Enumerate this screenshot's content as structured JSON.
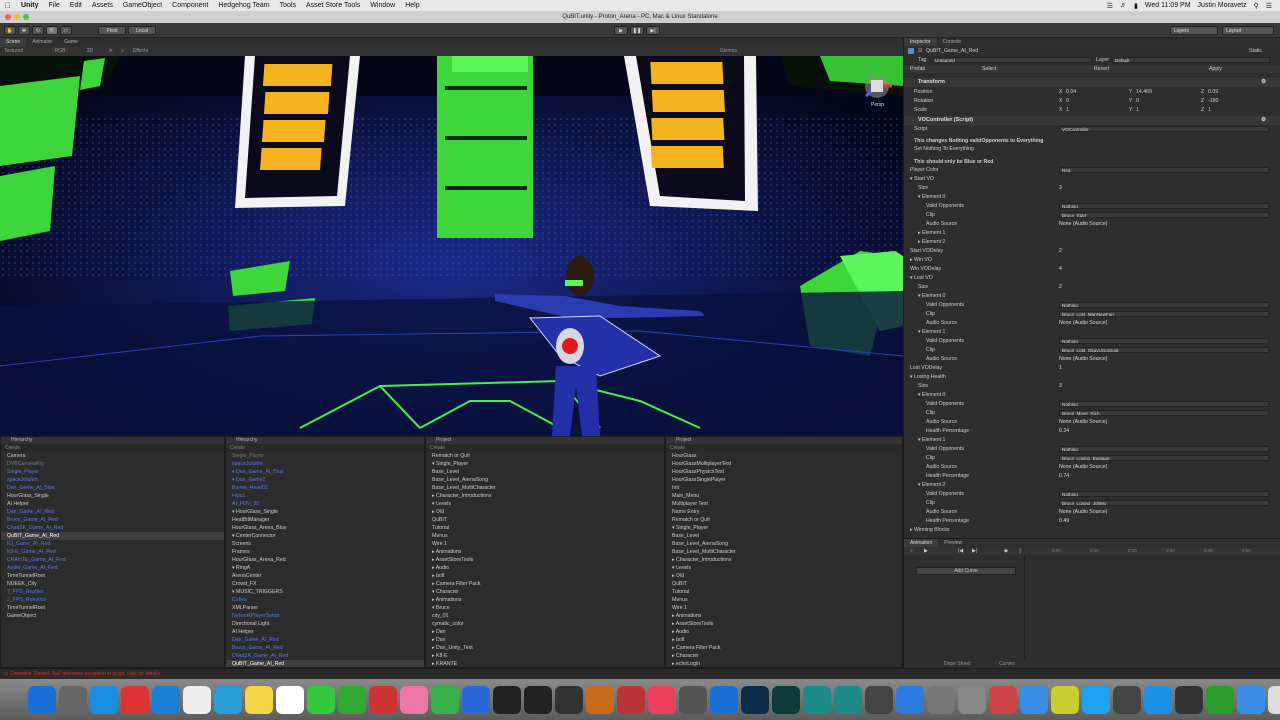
{
  "menubar": {
    "app": "Unity",
    "items": [
      "File",
      "Edit",
      "Assets",
      "GameObject",
      "Component",
      "Hedgehog Team",
      "Tools",
      "Asset Store Tools",
      "Window",
      "Help"
    ],
    "clock": "Wed 11:09 PM",
    "user": "Justin Moravetz"
  },
  "window_title": "QuBIT.unity - Proton_Arena - PC, Mac & Linux Standalone",
  "toolbar": {
    "pivot": "Pivot",
    "local": "Local",
    "layers": "Layers",
    "layout": "Layout"
  },
  "scene": {
    "tabs": [
      "Scene",
      "Animator",
      "Game"
    ],
    "shading": "Textured",
    "mode": "RGB",
    "twod": "2D",
    "effects": "Effects",
    "gizmos": "Gizmos",
    "persp": "Persp"
  },
  "hierarchy_left": {
    "title": "Hierarchy",
    "create": "Create",
    "items": [
      {
        "t": "Camera",
        "c": "n"
      },
      {
        "t": "DVBCameraRig",
        "c": "dim"
      },
      {
        "t": "Single_Player",
        "c": "blue"
      },
      {
        "t": "spaceJoluhm",
        "c": "blue"
      },
      {
        "t": "Dan_Game_AI_Blue",
        "c": "blue"
      },
      {
        "t": "HourGlass_Single",
        "c": "n"
      },
      {
        "t": "AI Helper",
        "c": "n"
      },
      {
        "t": "Dan_Game_AI_Red",
        "c": "blue"
      },
      {
        "t": "Bruce_Game_AI_Red",
        "c": "blue"
      },
      {
        "t": "ChadZK_Game_AI_Red",
        "c": "blue"
      },
      {
        "t": "QuBIT_Game_AI_Red",
        "c": "sel"
      },
      {
        "t": "Kit_Game_AI_Red",
        "c": "blue"
      },
      {
        "t": "K8-E_Game_AI_Red",
        "c": "blue"
      },
      {
        "t": "CRANTE_Game_AI_Red",
        "c": "blue"
      },
      {
        "t": "Audio_Game_AI_Red",
        "c": "blue"
      },
      {
        "t": "TimeTunnelRoot",
        "c": "n"
      },
      {
        "t": "NUEEK_City",
        "c": "n"
      },
      {
        "t": "7_FPS_Reptiler",
        "c": "blue"
      },
      {
        "t": "2_FPS_Robotics",
        "c": "blue"
      },
      {
        "t": "TimeTunnelRoot",
        "c": "n"
      },
      {
        "t": "GameObject",
        "c": "n"
      }
    ]
  },
  "hierarchy_right": {
    "title": "Hierarchy",
    "create": "Create",
    "items": [
      {
        "t": "Single_Player",
        "c": "dim"
      },
      {
        "t": "spaceJoluhm",
        "c": "blue"
      },
      {
        "t": "▾ Dan_Game_AI_Blue",
        "c": "blue"
      },
      {
        "t": "  ▾ Dan_Game2",
        "c": "blue"
      },
      {
        "t": "     Bones_Head03",
        "c": "blue"
      },
      {
        "t": "     Hips1",
        "c": "blue"
      },
      {
        "t": "     AI_FOV_90",
        "c": "blue"
      },
      {
        "t": "▾ HourGlass_Single",
        "c": "n"
      },
      {
        "t": "   HeatBitManager",
        "c": "n"
      },
      {
        "t": "   HourGlass_Arena_Blue",
        "c": "n"
      },
      {
        "t": "  ▾ CenterConnector",
        "c": "n"
      },
      {
        "t": "     Screens",
        "c": "n"
      },
      {
        "t": "     Frames",
        "c": "n"
      },
      {
        "t": "   HourGlass_Arena_Red",
        "c": "n"
      },
      {
        "t": "  ▾ RingA",
        "c": "n"
      },
      {
        "t": "   ArenaCenter",
        "c": "n"
      },
      {
        "t": "   Crowd_FX",
        "c": "n"
      },
      {
        "t": "  ▾ MUSIC_TRIGGERS",
        "c": "n"
      },
      {
        "t": "     Cubes",
        "c": "blue"
      },
      {
        "t": "     XMLParser",
        "c": "n"
      },
      {
        "t": "   NetworkPlayerSetup",
        "c": "blue"
      },
      {
        "t": "   Directional Light",
        "c": "n"
      },
      {
        "t": "AI Helper",
        "c": "n"
      },
      {
        "t": "Dan_Game_AI_Red",
        "c": "blue"
      },
      {
        "t": "Bruce_Game_AI_Red",
        "c": "blue"
      },
      {
        "t": "ChadZK_Game_AI_Red",
        "c": "blue"
      },
      {
        "t": "QuBIT_Game_AI_Red",
        "c": "sel"
      }
    ]
  },
  "project_left": {
    "title": "Project",
    "create": "Create",
    "items": [
      {
        "t": "    Rematch or Quit",
        "c": "n"
      },
      {
        "t": "  ▾ Single_Player",
        "c": "n"
      },
      {
        "t": "     Base_Level",
        "c": "n"
      },
      {
        "t": "     Base_Level_ArenaSong",
        "c": "n"
      },
      {
        "t": "     Base_Level_MultiCharacter",
        "c": "n"
      },
      {
        "t": "   ▸ Character_Introductions",
        "c": "n"
      },
      {
        "t": "   ▾ Levels",
        "c": "n"
      },
      {
        "t": "      ▸ Old",
        "c": "n"
      },
      {
        "t": "        QuBIT",
        "c": "n"
      },
      {
        "t": "        Tutorial",
        "c": "n"
      },
      {
        "t": "     Menus",
        "c": "n"
      },
      {
        "t": "   Wire 1",
        "c": "n"
      },
      {
        "t": "▸ Animations",
        "c": "n"
      },
      {
        "t": "▸ AssetStoreTools",
        "c": "n"
      },
      {
        "t": "▸ Audio",
        "c": "n"
      },
      {
        "t": "▸ bolt",
        "c": "n"
      },
      {
        "t": "▸ Camera Filter Pack",
        "c": "n"
      },
      {
        "t": "▾ Character",
        "c": "n"
      },
      {
        "t": "   ▸ Animations",
        "c": "n"
      },
      {
        "t": "   ▾ Bruce",
        "c": "n"
      },
      {
        "t": "      city_01",
        "c": "n"
      },
      {
        "t": "      cymatic_color",
        "c": "n"
      },
      {
        "t": "   ▸ Dan",
        "c": "n"
      },
      {
        "t": "   ▸ Dan",
        "c": "n"
      },
      {
        "t": "   ▸ Dan_Unity_Test",
        "c": "n"
      },
      {
        "t": "   ▸ K8-E",
        "c": "n"
      },
      {
        "t": "   ▸ KRANTE",
        "c": "n"
      }
    ]
  },
  "project_right": {
    "title": "Project",
    "create": "Create",
    "items": [
      {
        "t": "   HourGlass",
        "c": "n"
      },
      {
        "t": "   HourGlassMultiplayerTest",
        "c": "n"
      },
      {
        "t": "   HourGlassPhysicsTest",
        "c": "n"
      },
      {
        "t": "   HourGlassSinglePlayer",
        "c": "n"
      },
      {
        "t": "   Init",
        "c": "n"
      },
      {
        "t": "   Main_Menu",
        "c": "n"
      },
      {
        "t": "   Multiplayer Test",
        "c": "n"
      },
      {
        "t": "   Name Entry",
        "c": "n"
      },
      {
        "t": "   Rematch or Quit",
        "c": "n"
      },
      {
        "t": "  ▾ Single_Player",
        "c": "n"
      },
      {
        "t": "     Base_Level",
        "c": "n"
      },
      {
        "t": "     Base_Level_ArenaSong",
        "c": "n"
      },
      {
        "t": "     Base_Level_MultiCharacter",
        "c": "n"
      },
      {
        "t": "   ▸ Character_Introductions",
        "c": "n"
      },
      {
        "t": "   ▾ Levels",
        "c": "n"
      },
      {
        "t": "      ▸ Old",
        "c": "n"
      },
      {
        "t": "        QuBIT",
        "c": "n"
      },
      {
        "t": "        Tutorial",
        "c": "n"
      },
      {
        "t": "     Menus",
        "c": "n"
      },
      {
        "t": "   Wire 1",
        "c": "n"
      },
      {
        "t": "▸ Animations",
        "c": "n"
      },
      {
        "t": "▸ AssetStoreTools",
        "c": "n"
      },
      {
        "t": "▸ Audio",
        "c": "n"
      },
      {
        "t": "▸ bolt",
        "c": "n"
      },
      {
        "t": "▸ Camera Filter Pack",
        "c": "n"
      },
      {
        "t": "▸ Character",
        "c": "n"
      },
      {
        "t": "▸ echoLogin",
        "c": "n"
      }
    ]
  },
  "inspector": {
    "tabs": [
      "Inspector",
      "Console"
    ],
    "object_name": "QuBIT_Game_AI_Red",
    "static": "Static",
    "tag_label": "Tag",
    "tag_value": "Untagged",
    "layer_label": "Layer",
    "layer_value": "Default",
    "prefab_label": "Prefab",
    "prefab_select": "Select",
    "prefab_revert": "Revert",
    "prefab_apply": "Apply",
    "transform": {
      "title": "Transform",
      "rows": [
        {
          "label": "Position",
          "x": "0.04",
          "y": "14.469",
          "z": "0.09"
        },
        {
          "label": "Rotation",
          "x": "0",
          "y": "0",
          "z": "-180"
        },
        {
          "label": "Scale",
          "x": "1",
          "y": "1",
          "z": "1"
        }
      ]
    },
    "vo": {
      "title": "VOController (Script)",
      "script_label": "Script",
      "script_value": "VOController",
      "note1": "This changes Nothing validOpponents to Everything",
      "note1b": "Set Nothing To Everything",
      "note2": "This should only be Blue or Red",
      "rows": [
        {
          "label": "Player Color",
          "value": "Red",
          "ind": 0
        },
        {
          "label": "▾ Start VO",
          "value": "",
          "ind": 0
        },
        {
          "label": "Size",
          "value": "3",
          "ind": 1,
          "plain": true
        },
        {
          "label": "▾ Element 0",
          "value": "",
          "ind": 1
        },
        {
          "label": "Valid Opponents",
          "value": "Nothing",
          "ind": 2
        },
        {
          "label": "Clip",
          "value": "Bruce_Start",
          "ind": 2
        },
        {
          "label": "Audio Source",
          "value": "None (Audio Source)",
          "ind": 2,
          "plain": true
        },
        {
          "label": "▸ Element 1",
          "value": "",
          "ind": 1
        },
        {
          "label": "▸ Element 2",
          "value": "",
          "ind": 1
        },
        {
          "label": "Start VODelay",
          "value": "2",
          "ind": 0,
          "plain": true
        },
        {
          "label": "▸ Win VO",
          "value": "",
          "ind": 0
        },
        {
          "label": "Win VODelay",
          "value": "4",
          "ind": 0,
          "plain": true
        },
        {
          "label": "▾ Lost VO",
          "value": "",
          "ind": 0
        },
        {
          "label": "Size",
          "value": "2",
          "ind": 1,
          "plain": true
        },
        {
          "label": "▾ Element 0",
          "value": "",
          "ind": 1
        },
        {
          "label": "Valid Opponents",
          "value": "Nothing",
          "ind": 2
        },
        {
          "label": "Clip",
          "value": "Bruce_Lost_ManNewFan",
          "ind": 2
        },
        {
          "label": "Audio Source",
          "value": "None (Audio Source)",
          "ind": 2,
          "plain": true
        },
        {
          "label": "▾ Element 1",
          "value": "",
          "ind": 1
        },
        {
          "label": "Valid Opponents",
          "value": "Nothing",
          "ind": 2
        },
        {
          "label": "Clip",
          "value": "Bruce_Lost_OkayUGotSoul",
          "ind": 2
        },
        {
          "label": "Audio Source",
          "value": "None (Audio Source)",
          "ind": 2,
          "plain": true
        },
        {
          "label": "Lost VODelay",
          "value": "1",
          "ind": 0,
          "plain": true
        },
        {
          "label": "▾ Losing Health",
          "value": "",
          "ind": 0
        },
        {
          "label": "Size",
          "value": "3",
          "ind": 1,
          "plain": true
        },
        {
          "label": "▾ Element 0",
          "value": "",
          "ind": 1
        },
        {
          "label": "Valid Opponents",
          "value": "Nothing",
          "ind": 2
        },
        {
          "label": "Clip",
          "value": "Bruce_Move_Rich",
          "ind": 2
        },
        {
          "label": "Audio Source",
          "value": "None (Audio Source)",
          "ind": 2,
          "plain": true
        },
        {
          "label": "Health Percentage",
          "value": "0.24",
          "ind": 2,
          "plain": true
        },
        {
          "label": "▾ Element 1",
          "value": "",
          "ind": 1
        },
        {
          "label": "Valid Opponents",
          "value": "Nothing",
          "ind": 2
        },
        {
          "label": "Clip",
          "value": "Bruce_Losing_Bustage",
          "ind": 2
        },
        {
          "label": "Audio Source",
          "value": "None (Audio Source)",
          "ind": 2,
          "plain": true
        },
        {
          "label": "Health Percentage",
          "value": "0.74",
          "ind": 2,
          "plain": true
        },
        {
          "label": "▾ Element 2",
          "value": "",
          "ind": 1
        },
        {
          "label": "Valid Opponents",
          "value": "Nothing",
          "ind": 2
        },
        {
          "label": "Clip",
          "value": "Bruce_Losing_JohMo",
          "ind": 2
        },
        {
          "label": "Audio Source",
          "value": "None (Audio Source)",
          "ind": 2,
          "plain": true
        },
        {
          "label": "Health Percentage",
          "value": "0.49",
          "ind": 2,
          "plain": true
        },
        {
          "label": "▸ Winning Blocks",
          "value": "",
          "ind": 0
        }
      ]
    }
  },
  "animation": {
    "tabs": [
      "Animation",
      "Preview"
    ],
    "add_curve": "Add Curve",
    "dopesheet": "Dope Sheet",
    "curves": "Curves",
    "ticks": [
      "0:00",
      "0:10",
      "0:20",
      "0:30",
      "0:40",
      "0:50",
      "1:00"
    ]
  },
  "status": "Coroutine Started: Null reference exception in script, click for details",
  "dock": {
    "icons": [
      "finder-icon",
      "launchpad-icon",
      "safari-icon",
      "calendar-icon",
      "mail-icon",
      "calendar-icon",
      "preview-icon",
      "notes-icon",
      "textedit-icon",
      "messages-icon",
      "facetime-icon",
      "photo-booth-icon",
      "photos-icon",
      "numbers-icon",
      "keynote-icon",
      "unity-icon",
      "unity-icon",
      "unity-icon",
      "box-icon",
      "poser-icon",
      "itunes-icon",
      "final-cut-icon",
      "finder-icon",
      "photoshop-icon",
      "audition-icon",
      "maya-icon",
      "maya-icon",
      "ink-icon",
      "app-store-icon",
      "system-preferences-icon",
      "preferences-icon",
      "chrome-icon",
      "chrome-icon",
      "chrome-icon",
      "skype-icon",
      "unity-icon",
      "skype-icon",
      "screen-icon",
      "stage-icon",
      "folder-icon",
      "trash-icon"
    ],
    "colors": [
      "#1a6fd6",
      "#666",
      "#1a8ee0",
      "#d33",
      "#1b7fd4",
      "#eee",
      "#2a9fd6",
      "#f5d547",
      "#fff",
      "#36c740",
      "#3a3",
      "#c33",
      "#e7a",
      "#38b24a",
      "#2a6ad6",
      "#222",
      "#222",
      "#333",
      "#c76b1a",
      "#b33",
      "#ec3f5c",
      "#555",
      "#1a6fd6",
      "#0b2d4a",
      "#0d3c3a",
      "#1c8b88",
      "#1c8b88",
      "#444",
      "#2a7ae0",
      "#777",
      "#888",
      "#c44",
      "#3a8ee6",
      "#cc3",
      "#1da1f2",
      "#444",
      "#1a93e6",
      "#333",
      "#2a9d2a",
      "#3a8ee6",
      "#ddd"
    ]
  }
}
